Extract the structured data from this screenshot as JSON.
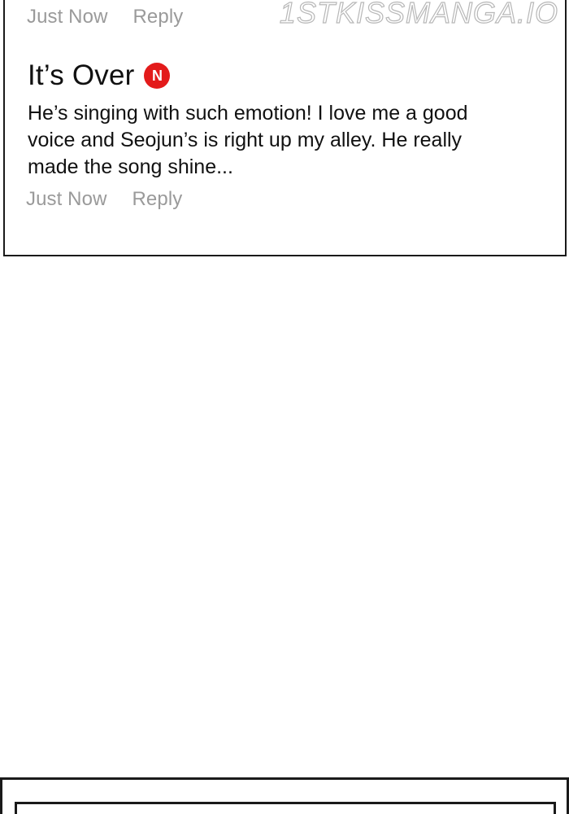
{
  "watermark": "1STKISSMANGA.IO",
  "previous_comment": {
    "time": "Just Now",
    "reply_label": "Reply"
  },
  "comment": {
    "author": "It’s Over",
    "badge": "N",
    "badge_color": "#e31b1b",
    "text": "He’s singing with such emotion! I love me a good voice and Seojun’s is right up my alley. He really made the song shine...",
    "time": "Just Now",
    "reply_label": "Reply"
  }
}
